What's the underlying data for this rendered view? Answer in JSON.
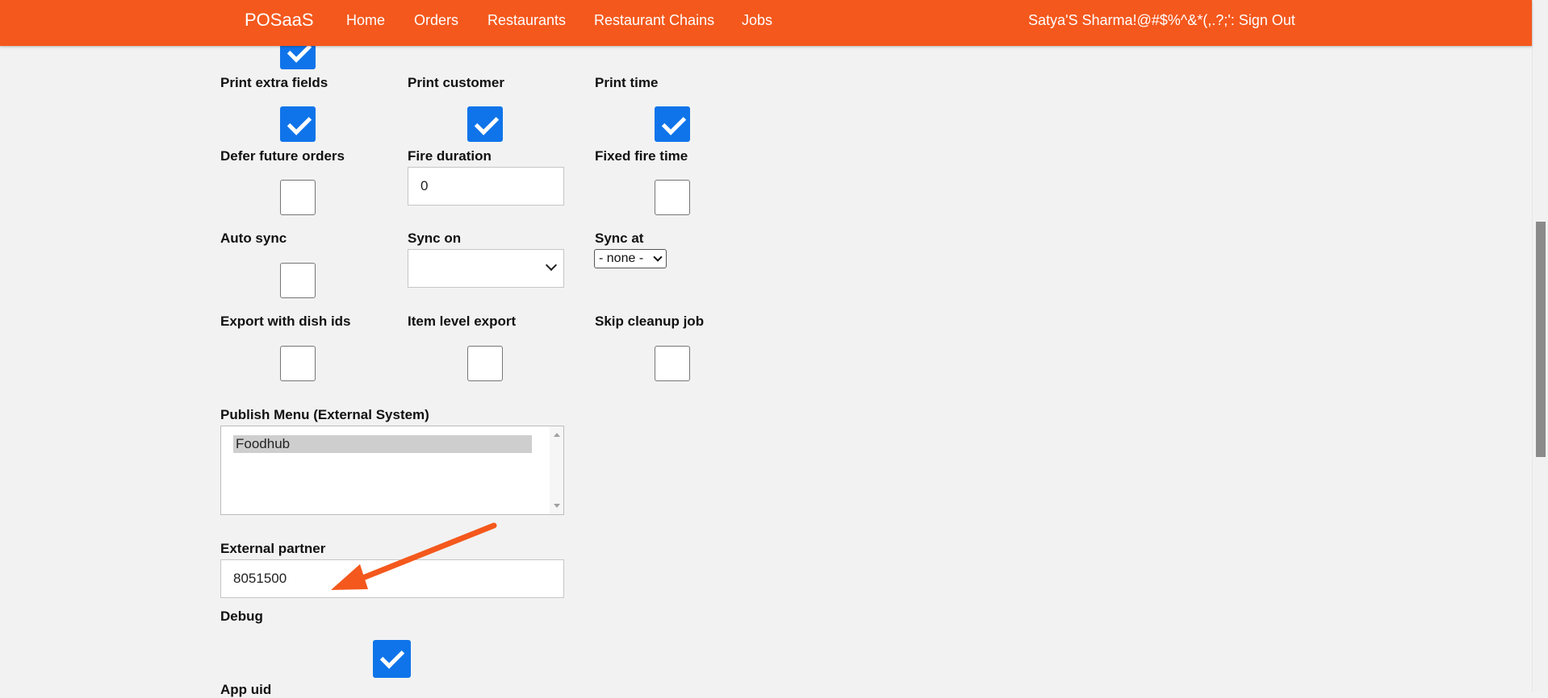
{
  "nav": {
    "brand": "POSaaS",
    "links": [
      "Home",
      "Orders",
      "Restaurants",
      "Restaurant Chains",
      "Jobs"
    ],
    "user": "Satya'S Sharma!@#$%^&*(,.?;': Sign Out"
  },
  "form": {
    "print_extra_fields": "Print extra fields",
    "print_customer": "Print customer",
    "print_time": "Print time",
    "defer_future_orders": "Defer future orders",
    "fire_duration": "Fire duration",
    "fire_duration_value": "0",
    "fixed_fire_time": "Fixed fire time",
    "auto_sync": "Auto sync",
    "sync_on": "Sync on",
    "sync_at": "Sync at",
    "sync_at_value": "- none -",
    "export_with_dish_ids": "Export with dish ids",
    "item_level_export": "Item level export",
    "skip_cleanup_job": "Skip cleanup job",
    "publish_menu": "Publish Menu (External System)",
    "publish_menu_option": "Foodhub",
    "external_partner": "External partner",
    "external_partner_value": "8051500",
    "debug": "Debug",
    "app_uid": "App uid"
  },
  "checkbox_states": {
    "top_partial": true,
    "print_extra_fields": true,
    "print_customer": true,
    "print_time": true,
    "defer_future_orders": false,
    "fixed_fire_time": false,
    "auto_sync": false,
    "export_with_dish_ids": false,
    "item_level_export": false,
    "skip_cleanup_job": false,
    "debug": true
  },
  "colors": {
    "navbar": "#f4581c",
    "checkbox_checked": "#0f74ea",
    "annotation_arrow": "#f4581c"
  }
}
